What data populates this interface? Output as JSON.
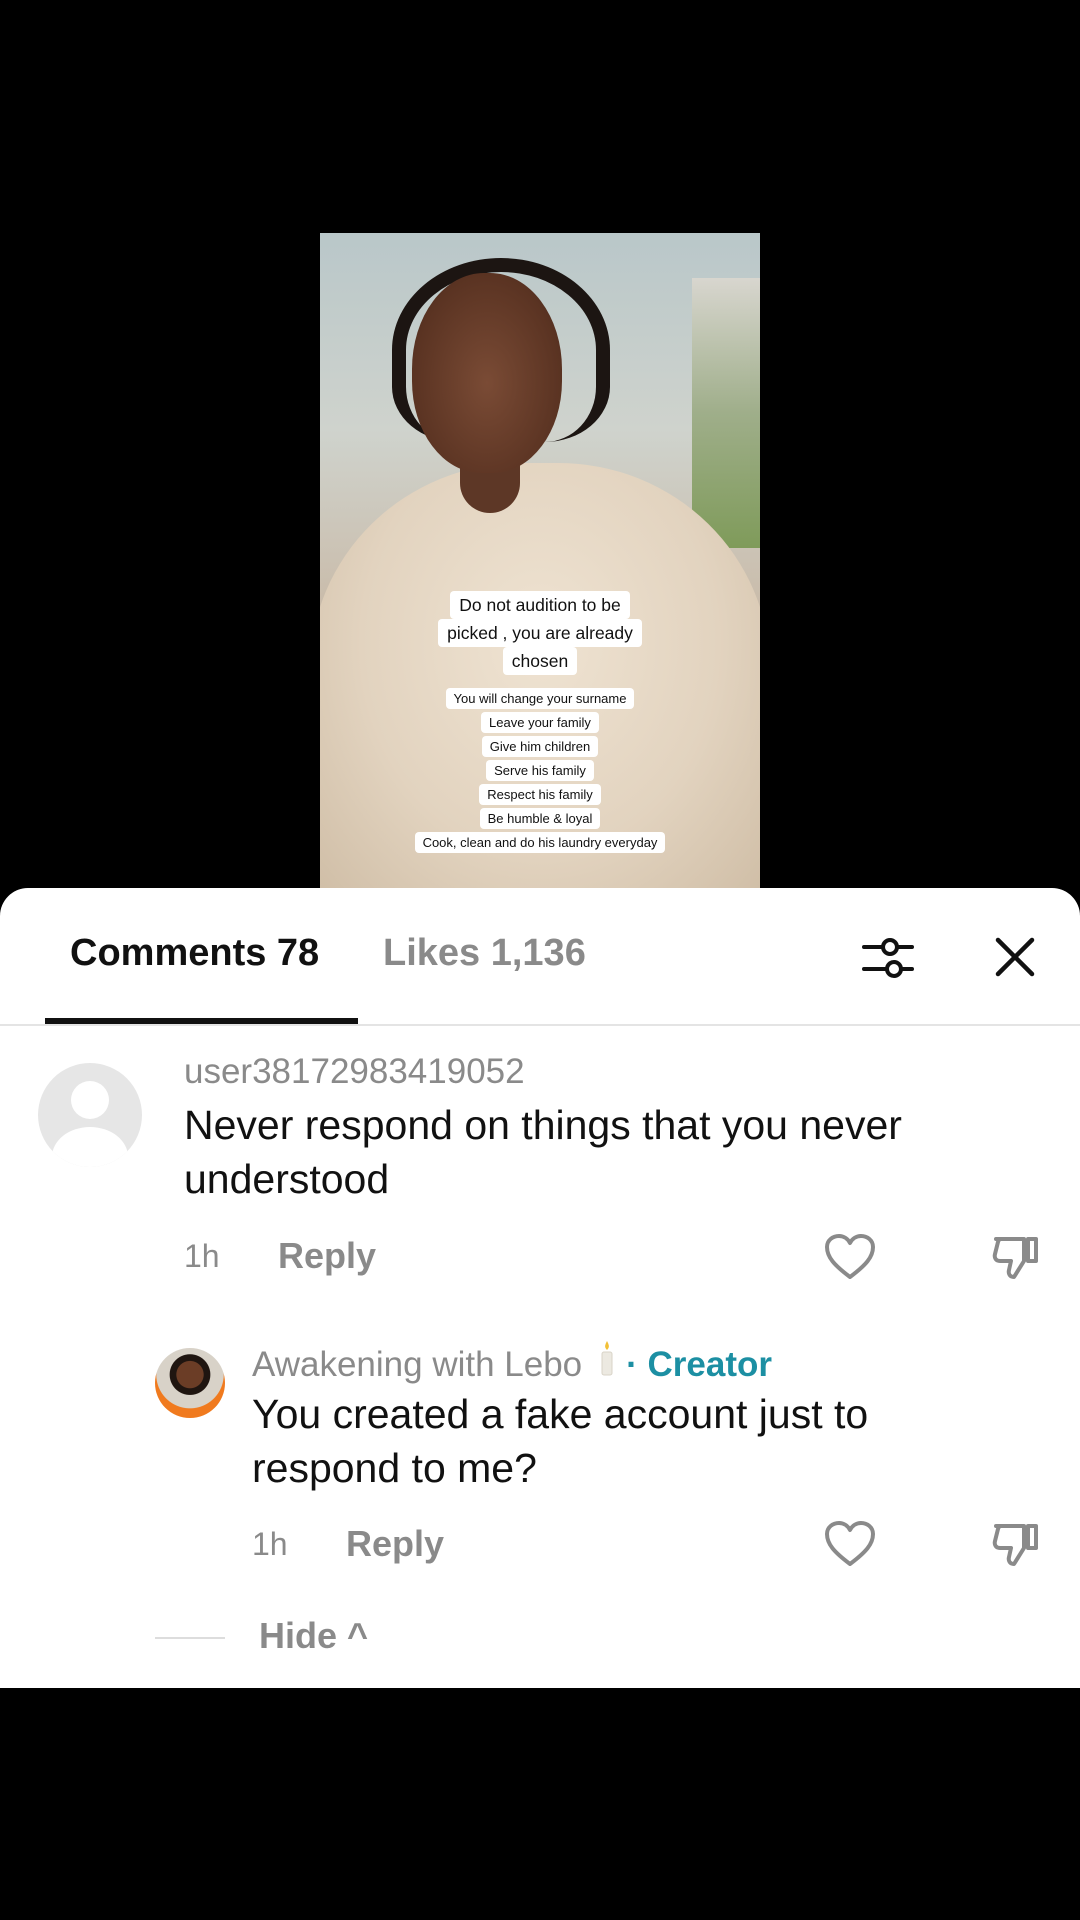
{
  "video": {
    "caption_main": [
      "Do not audition to be",
      "picked , you are already",
      "chosen"
    ],
    "caption_list": [
      "You will change your surname",
      "Leave your family",
      "Give him children",
      "Serve his family",
      "Respect his family",
      "Be humble & loyal",
      "Cook, clean and do his laundry everyday"
    ]
  },
  "tabs": {
    "comments_label": "Comments 78",
    "likes_label": "Likes 1,136"
  },
  "comments": [
    {
      "username": "user38172983419052",
      "text_line1": "Never respond on things that you never",
      "text_line2": "understood",
      "time": "1h",
      "reply_label": "Reply"
    },
    {
      "username": "Awakening with Lebo",
      "badge": "· Creator",
      "text_line1": "You created a fake account just to",
      "text_line2": "respond to me?",
      "time": "1h",
      "reply_label": "Reply"
    }
  ],
  "hide_label": "Hide ^",
  "icons": [
    "filter-icon",
    "close-icon",
    "heart-icon",
    "dislike-icon",
    "candle-icon",
    "default-avatar-icon"
  ],
  "colors": {
    "creator": "#1c8fa3",
    "muted": "#8a8a8a",
    "text": "#111111"
  }
}
